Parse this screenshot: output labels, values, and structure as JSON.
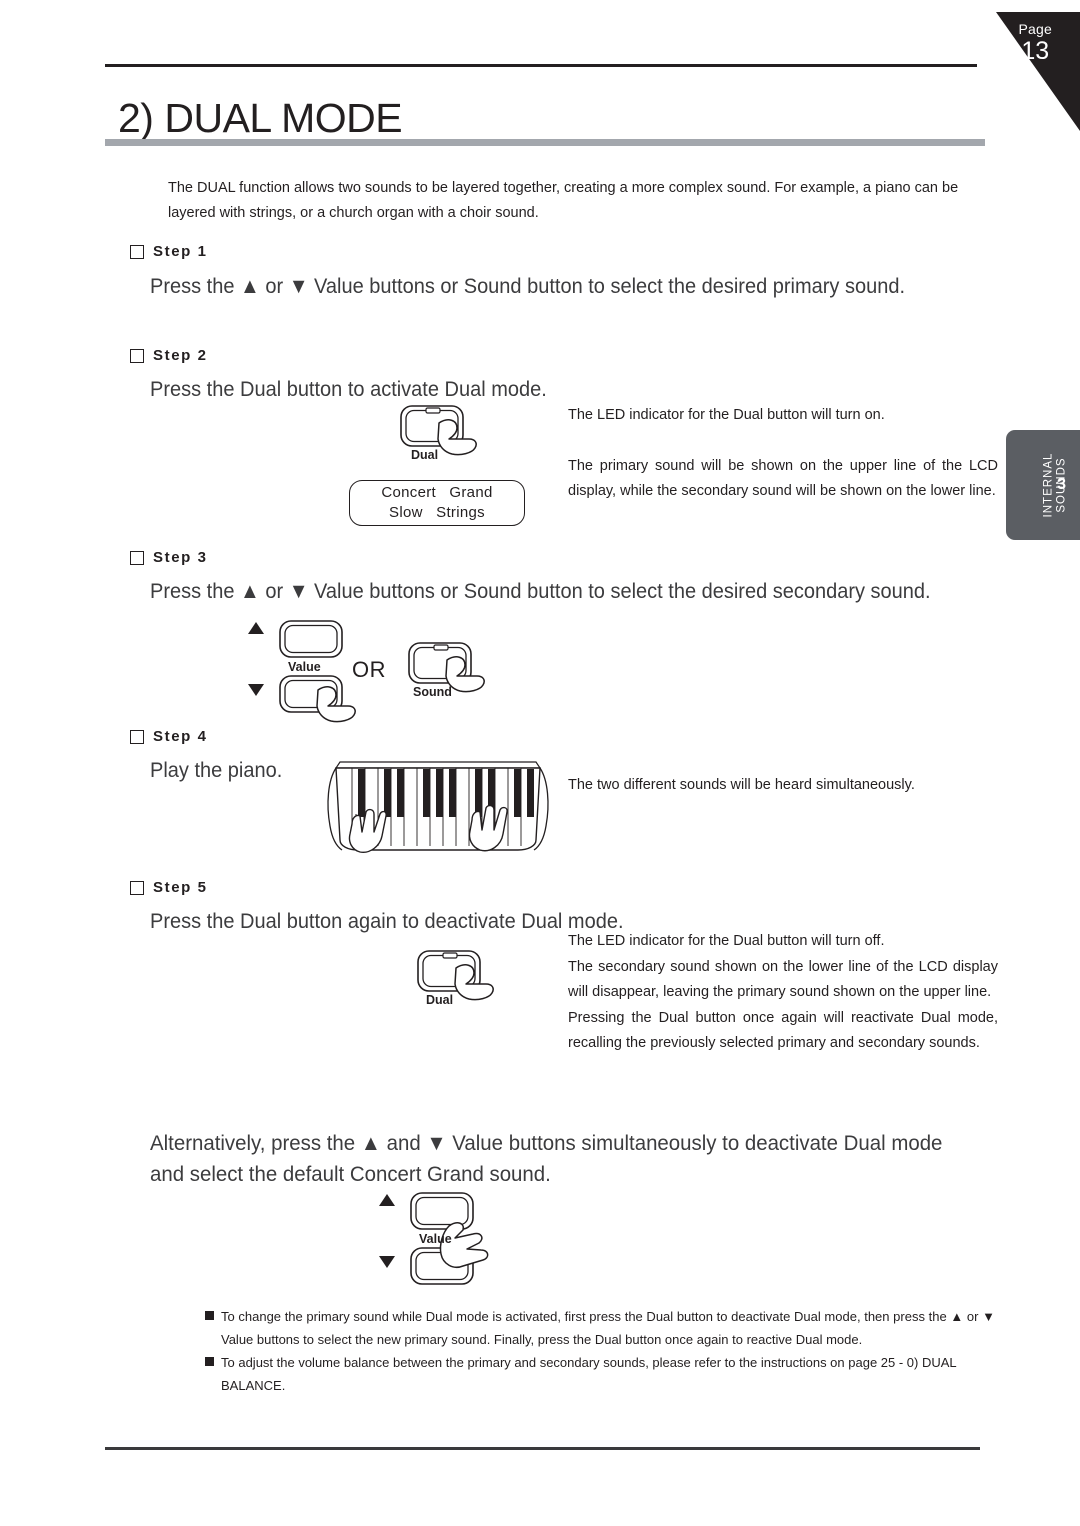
{
  "page": {
    "corner": {
      "label": "Page",
      "number": "13"
    },
    "title": "2) DUAL MODE",
    "intro": "The DUAL function allows two sounds to be layered together, creating a more complex sound. For example, a piano can be layered with strings, or a church organ with a choir sound."
  },
  "side_tab": {
    "line1": "INTERNAL",
    "line2": "SOUNDS",
    "number": "3"
  },
  "steps": [
    {
      "label": "Step 1",
      "heading": "Press the ▲ or ▼ Value buttons or Sound button to select the desired primary sound."
    },
    {
      "label": "Step 2",
      "heading": "Press the Dual button to activate Dual mode.",
      "notes": [
        "The LED indicator for the Dual button will turn on.",
        "The primary sound will be shown on the upper line of the LCD display, while the secondary sound will be shown on the lower line."
      ]
    },
    {
      "label": "Step 3",
      "heading": "Press the ▲ or ▼ Value buttons or Sound button to select the desired secondary sound."
    },
    {
      "label": "Step 4",
      "heading": "Play the piano.",
      "notes": [
        "The two different sounds will be heard simultaneously."
      ]
    },
    {
      "label": "Step 5",
      "heading": "Press the Dual button again to deactivate Dual mode.",
      "notes": [
        "The LED indicator for the Dual button will turn off.",
        "The secondary sound shown on the lower line of the LCD display will disappear, leaving the primary sound shown on the upper line.",
        "Pressing the Dual button once again will reactivate Dual mode, recalling the previously selected primary and secondary sounds."
      ]
    }
  ],
  "lcd": {
    "upper": "Concert   Grand",
    "lower": "Slow   Strings"
  },
  "buttons": {
    "dual_caption": "Dual",
    "value_caption": "Value",
    "sound_caption": "Sound",
    "or_label": "OR",
    "up_arrow": "▲",
    "down_arrow": "▼"
  },
  "alternative": "Alternatively, press the ▲ and ▼ Value buttons simultaneously to deactivate Dual mode and select the default Concert Grand sound.",
  "footer_notes": [
    "To change the primary sound while Dual mode is activated, first press the Dual button to deactivate Dual mode, then press the ▲ or ▼ Value buttons to select the new primary sound.  Finally, press the Dual button once again to reactive Dual mode.",
    "To adjust the volume balance between the primary and secondary sounds, please refer to the instructions on page 25 - 0) DUAL BALANCE."
  ],
  "colors": {
    "ink": "#231f20",
    "gray_bar": "#a3a7ad",
    "tab": "#5b5e63"
  }
}
